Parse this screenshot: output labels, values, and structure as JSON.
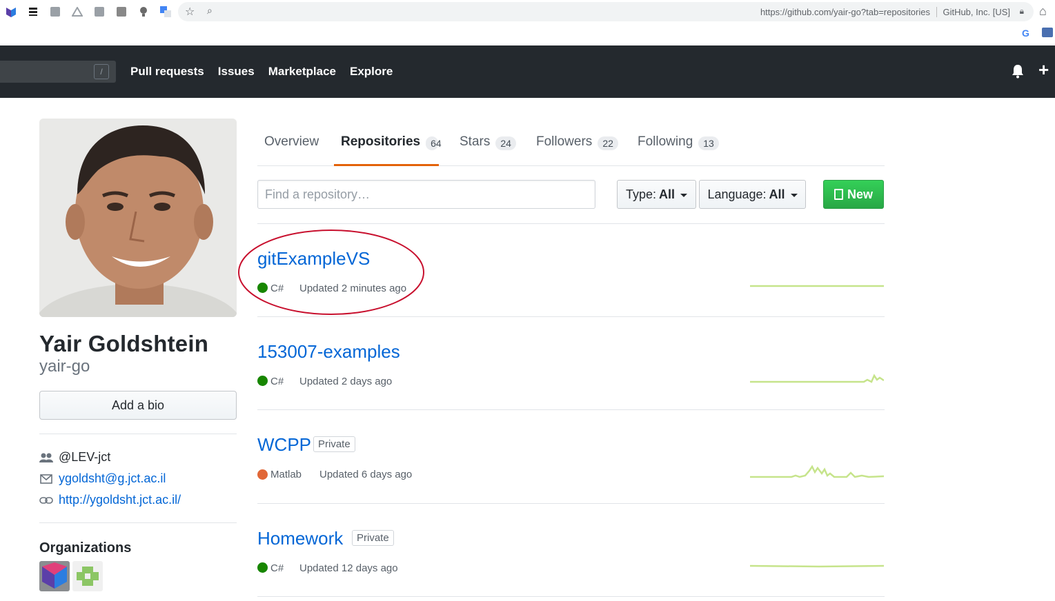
{
  "browser": {
    "url": "https://github.com/yair-go?tab=repositories",
    "cert": "GitHub, Inc. [US]"
  },
  "header": {
    "search_key": "/",
    "nav": [
      "Pull requests",
      "Issues",
      "Marketplace",
      "Explore"
    ]
  },
  "profile": {
    "full_name": "Yair Goldshtein",
    "username": "yair-go",
    "bio_button": "Add a bio",
    "org_handle": "@LEV-jct",
    "email": "ygoldsht@g.jct.ac.il",
    "website": "http://ygoldsht.jct.ac.il/",
    "organizations_title": "Organizations"
  },
  "tabs": [
    {
      "label": "Overview",
      "count": ""
    },
    {
      "label": "Repositories",
      "count": "64"
    },
    {
      "label": "Stars",
      "count": "24"
    },
    {
      "label": "Followers",
      "count": "22"
    },
    {
      "label": "Following",
      "count": "13"
    }
  ],
  "filters": {
    "search_placeholder": "Find a repository…",
    "type_label": "Type:",
    "type_value": "All",
    "language_label": "Language:",
    "language_value": "All",
    "new_label": "New"
  },
  "repos": [
    {
      "name": "gitExampleVS",
      "private": "",
      "language": "C#",
      "lang_color": "#178600",
      "updated": "Updated 2 minutes ago"
    },
    {
      "name": "153007-examples",
      "private": "",
      "language": "C#",
      "lang_color": "#178600",
      "updated": "Updated 2 days ago"
    },
    {
      "name": "WCPP",
      "private": "Private",
      "language": "Matlab",
      "lang_color": "#e16737",
      "updated": "Updated 6 days ago"
    },
    {
      "name": "Homework",
      "private": "Private",
      "language": "C#",
      "lang_color": "#178600",
      "updated": "Updated 12 days ago"
    }
  ],
  "colors": {
    "header_bg": "#24292e",
    "link": "#0366d6",
    "tab_accent": "#e36209",
    "new_button": "#28a745",
    "spark_line": "#c6e48b",
    "annotation": "#c8102e"
  }
}
